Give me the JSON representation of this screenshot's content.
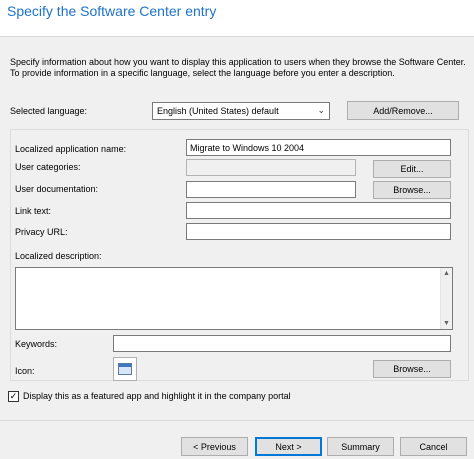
{
  "header": {
    "title": "Specify the Software Center entry"
  },
  "description": "Specify information about how you want to display this application to users when they browse the Software Center. To provide information in a specific language, select the language before you enter a description.",
  "language": {
    "label": "Selected language:",
    "selected": "English (United States) default",
    "add_remove_label": "Add/Remove..."
  },
  "form": {
    "app_name_label": "Localized application name:",
    "app_name_value": "Migrate to Windows 10 2004",
    "user_categories_label": "User categories:",
    "user_categories_value": "",
    "edit_label": "Edit...",
    "user_documentation_label": "User documentation:",
    "user_documentation_value": "",
    "browse_label": "Browse...",
    "link_text_label": "Link text:",
    "link_text_value": "",
    "privacy_url_label": "Privacy URL:",
    "privacy_url_value": "",
    "localized_description_label": "Localized description:",
    "keywords_label": "Keywords:",
    "keywords_value": "",
    "icon_label": "Icon:",
    "icon_browse_label": "Browse..."
  },
  "featured": {
    "checked": true,
    "check_glyph": "✓",
    "label": "Display this as a featured app and highlight it in the company portal"
  },
  "footer": {
    "previous_label": "< Previous",
    "next_label": "Next >",
    "summary_label": "Summary",
    "cancel_label": "Cancel"
  },
  "colors": {
    "title": "#1e73c9",
    "primary_border": "#0078d7"
  }
}
